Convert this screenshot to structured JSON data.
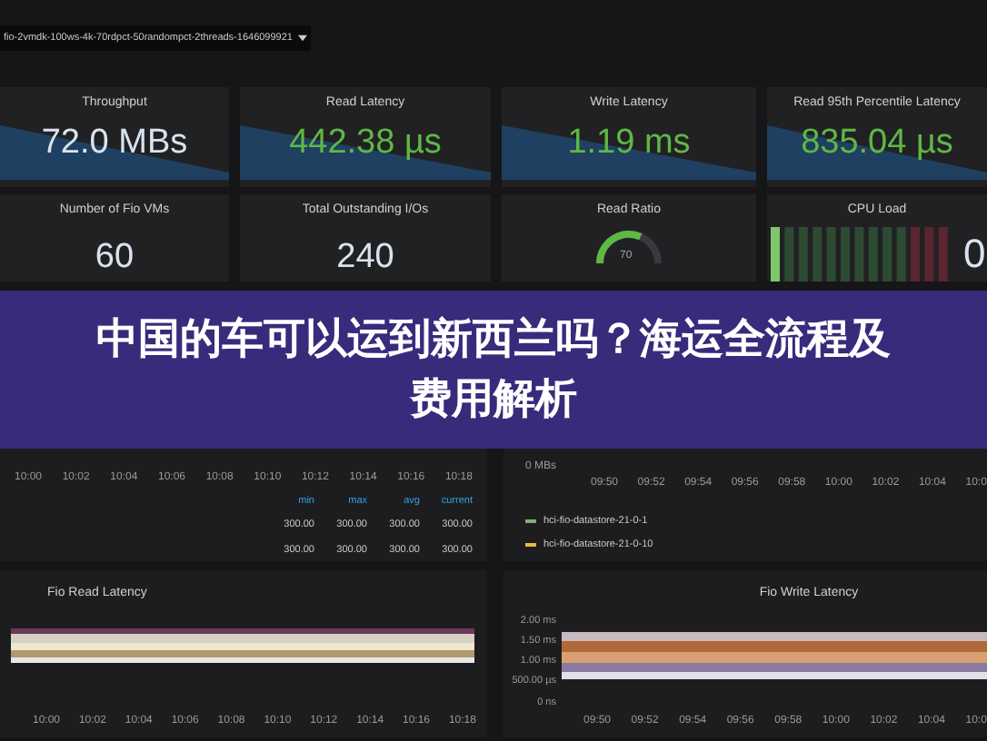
{
  "dashboard_selector": {
    "label": "fio-2vmdk-100ws-4k-70rdpct-50randompct-2threads-1646099921"
  },
  "stat_panels": [
    {
      "title": "Throughput",
      "value": "72.0 MBs",
      "kind": "sparkline",
      "color": "#d8e3ef"
    },
    {
      "title": "Read Latency",
      "value": "442.38 µs",
      "kind": "sparkline",
      "color": "#5fb845"
    },
    {
      "title": "Write Latency",
      "value": "1.19 ms",
      "kind": "sparkline",
      "color": "#5fb845"
    },
    {
      "title": "Read 95th Percentile Latency",
      "value": "835.04 µs",
      "kind": "sparkline",
      "color": "#5fb845"
    },
    {
      "title": "Number of Fio VMs",
      "value": "60",
      "kind": "plain",
      "color": "#d8e3ef"
    },
    {
      "title": "Total Outstanding I/Os",
      "value": "240",
      "kind": "plain",
      "color": "#d8e3ef"
    },
    {
      "title": "Read Ratio",
      "value": "70",
      "kind": "gauge",
      "level": 0.7,
      "color": "#5fb845"
    },
    {
      "title": "CPU Load",
      "value": "0",
      "kind": "bars",
      "color": "#d8e3ef"
    }
  ],
  "headline": "中国的车可以运到新西兰吗？海运全流程及费用解析",
  "throughput_panel": {
    "x_ticks": [
      "10:00",
      "10:02",
      "10:04",
      "10:06",
      "10:08",
      "10:10",
      "10:12",
      "10:14",
      "10:16",
      "10:18"
    ],
    "legend_columns": [
      "min",
      "max",
      "avg",
      "current"
    ],
    "legend_rows": [
      [
        "300.00",
        "300.00",
        "300.00",
        "300.00"
      ],
      [
        "300.00",
        "300.00",
        "300.00",
        "300.00"
      ]
    ]
  },
  "bandwidth_panel": {
    "y_tick": "0 MBs",
    "x_ticks": [
      "09:50",
      "09:52",
      "09:54",
      "09:56",
      "09:58",
      "10:00",
      "10:02",
      "10:04",
      "10:0"
    ],
    "legend": [
      {
        "name": "hci-fio-datastore-21-0-1",
        "color": "#7eb26d"
      },
      {
        "name": "hci-fio-datastore-21-0-10",
        "color": "#eab839"
      }
    ]
  },
  "read_latency_panel": {
    "title": "Fio Read Latency",
    "x_ticks": [
      "10:00",
      "10:02",
      "10:04",
      "10:06",
      "10:08",
      "10:10",
      "10:12",
      "10:14",
      "10:16",
      "10:18"
    ]
  },
  "write_latency_panel": {
    "title": "Fio Write Latency",
    "y_ticks": [
      "2.00 ms",
      "1.50 ms",
      "1.00 ms",
      "500.00 µs",
      "0 ns"
    ],
    "x_ticks": [
      "09:50",
      "09:52",
      "09:54",
      "09:56",
      "09:58",
      "10:00",
      "10:02",
      "10:04",
      "10:0"
    ]
  }
}
